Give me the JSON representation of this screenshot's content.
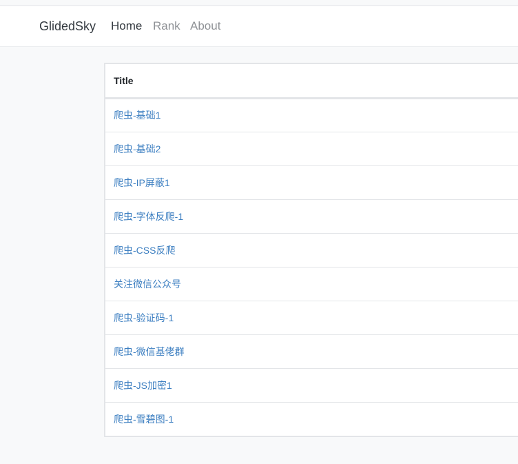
{
  "nav": {
    "brand": "GlidedSky",
    "links": [
      {
        "label": "Home"
      },
      {
        "label": "Rank"
      },
      {
        "label": "About"
      }
    ]
  },
  "table": {
    "header": "Title",
    "rows": [
      {
        "title": "爬虫-基础1"
      },
      {
        "title": "爬虫-基础2"
      },
      {
        "title": "爬虫-IP屏蔽1"
      },
      {
        "title": "爬虫-字体反爬-1"
      },
      {
        "title": "爬虫-CSS反爬"
      },
      {
        "title": "关注微信公众号"
      },
      {
        "title": "爬虫-验证码-1"
      },
      {
        "title": "爬虫-微信基佬群"
      },
      {
        "title": "爬虫-JS加密1"
      },
      {
        "title": "爬虫-雪碧图-1"
      }
    ]
  }
}
